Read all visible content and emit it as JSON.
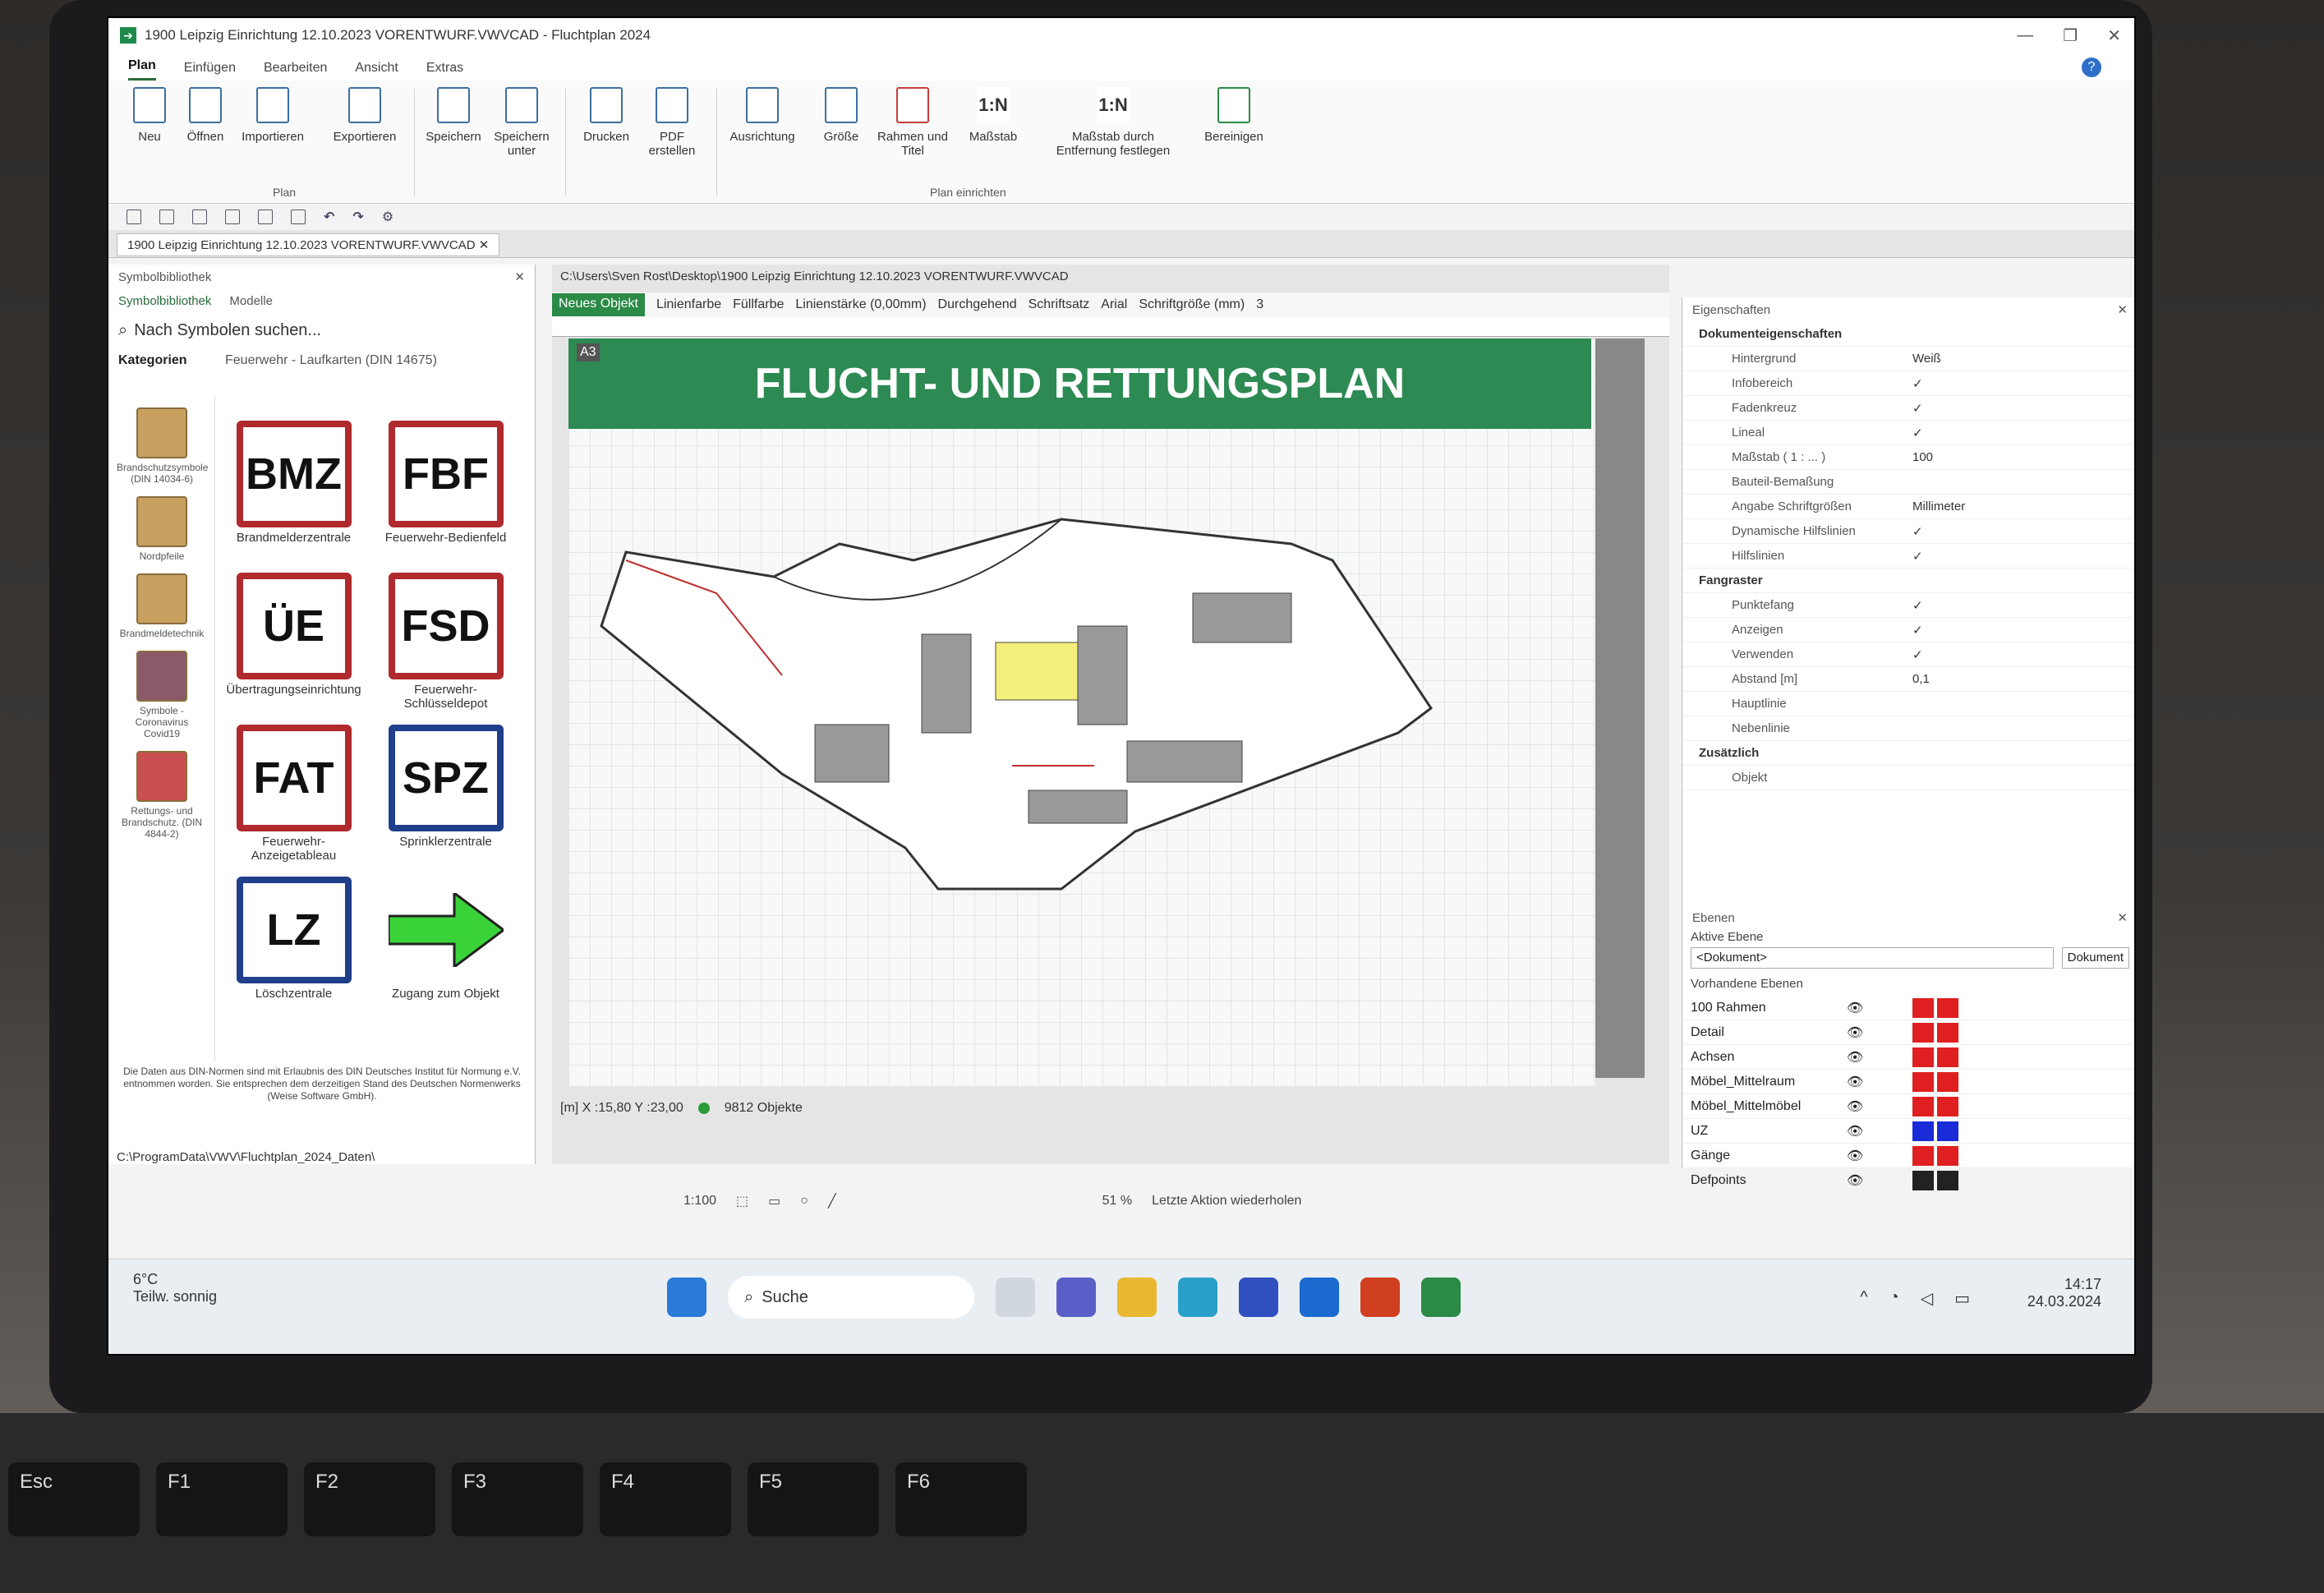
{
  "window": {
    "title": "1900 Leipzig Einrichtung 12.10.2023 VORENTWURF.VWVCAD - Fluchtplan 2024"
  },
  "ribbon": {
    "tabs": [
      "Plan",
      "Einfügen",
      "Bearbeiten",
      "Ansicht",
      "Extras"
    ],
    "buttons": {
      "neu": "Neu",
      "oeffnen": "Öffnen",
      "importieren": "Importieren",
      "exportieren": "Exportieren",
      "speichern": "Speichern",
      "speichern_unter": "Speichern unter",
      "drucken": "Drucken",
      "pdf": "PDF erstellen",
      "ausrichtung": "Ausrichtung",
      "groesse": "Größe",
      "rahmen": "Rahmen und Titel",
      "massstab": "Maßstab",
      "massstab_entf": "Maßstab durch Entfernung festlegen",
      "bereinigen": "Bereinigen"
    },
    "groups": {
      "plan": "Plan",
      "plan_einrichten": "Plan einrichten"
    },
    "scale_icon": "1:N"
  },
  "doc_tab": "1900 Leipzig Einrichtung 12.10.2023 VORENTWURF.VWVCAD",
  "library": {
    "title": "Symbolbibliothek",
    "tab_symbols": "Symbolbibliothek",
    "tab_models": "Modelle",
    "search_placeholder": "Nach Symbolen suchen...",
    "categories_label": "Kategorien",
    "folder": "Feuerwehr - Laufkarten (DIN 14675)",
    "categories": [
      "Brandschutzsymbole (DIN 14034-6)",
      "Nordpfeile",
      "Brandmeldetechnik",
      "Symbole - Coronavirus Covid19",
      "Rettungs- und Brandschutz. (DIN 4844-2)"
    ],
    "symbols": [
      {
        "code": "BMZ",
        "label": "Brandmelderzentrale"
      },
      {
        "code": "FBF",
        "label": "Feuerwehr-Bedienfeld"
      },
      {
        "code": "ÜE",
        "label": "Übertragungseinrichtung"
      },
      {
        "code": "FSD",
        "label": "Feuerwehr-Schlüsseldepot"
      },
      {
        "code": "FAT",
        "label": "Feuerwehr-Anzeigetableau"
      },
      {
        "code": "SPZ",
        "label": "Sprinklerzentrale"
      },
      {
        "code": "LZ",
        "label": "Löschzentrale"
      },
      {
        "code": "",
        "label": "Zugang zum Objekt"
      }
    ],
    "legal": "Die Daten aus DIN-Normen sind mit Erlaubnis des DIN Deutsches Institut für Normung e.V. entnommen worden. Sie entsprechen dem derzeitigen Stand des Deutschen Normenwerks (Weise Software GmbH).",
    "path": "C:\\ProgramData\\VWV\\Fluchtplan_2024_Daten\\"
  },
  "canvas": {
    "path": "C:\\Users\\Sven Rost\\Desktop\\1900 Leipzig Einrichtung 12.10.2023 VORENTWURF.VWVCAD",
    "new_object": "Neues Objekt",
    "toolbar": [
      "Linienfarbe",
      "Füllfarbe",
      "Linienstärke (0,00mm)",
      "Durchgehend",
      "Schriftsatz",
      "Arial",
      "Schriftgröße (mm)",
      "3"
    ],
    "paper": "A3",
    "plan_title": "FLUCHT- UND RETTUNGSPLAN",
    "coords": "[m] X :15,80 Y :23,00",
    "objects": "9812 Objekte",
    "scale": "1:100",
    "zoom": "51 %",
    "repeat": "Letzte Aktion wiederholen"
  },
  "properties": {
    "title": "Eigenschaften",
    "section_doc": "Dokumenteigenschaften",
    "rows": [
      {
        "name": "Hintergrund",
        "value": "Weiß"
      },
      {
        "name": "Infobereich",
        "value": "✓"
      },
      {
        "name": "Fadenkreuz",
        "value": "✓"
      },
      {
        "name": "Lineal",
        "value": "✓"
      },
      {
        "name": "Maßstab ( 1 : ... )",
        "value": "100"
      },
      {
        "name": "Bauteil-Bemaßung",
        "value": ""
      },
      {
        "name": "Angabe Schriftgrößen",
        "value": "Millimeter"
      },
      {
        "name": "Dynamische Hilfslinien",
        "value": "✓"
      },
      {
        "name": "Hilfslinien",
        "value": "✓"
      }
    ],
    "section_grid": "Fangraster",
    "grid_rows": [
      {
        "name": "Punktefang",
        "value": "✓"
      },
      {
        "name": "Anzeigen",
        "value": "✓"
      },
      {
        "name": "Verwenden",
        "value": "✓"
      },
      {
        "name": "Abstand [m]",
        "value": "0,1"
      },
      {
        "name": "Hauptlinie",
        "value": ""
      },
      {
        "name": "Nebenlinie",
        "value": ""
      }
    ],
    "section_extra": "Zusätzlich",
    "extra_rows": [
      {
        "name": "Objekt",
        "value": ""
      }
    ]
  },
  "layers": {
    "title": "Ebenen",
    "active_label": "Aktive Ebene",
    "active_value": "<Dokument>",
    "doc_button": "Dokument",
    "existing_label": "Vorhandene Ebenen",
    "items": [
      {
        "name": "100 Rahmen",
        "color": "#e02020"
      },
      {
        "name": "Detail",
        "color": "#e02020"
      },
      {
        "name": "Achsen",
        "color": "#e02020"
      },
      {
        "name": "Möbel_Mittelraum",
        "color": "#e02020"
      },
      {
        "name": "Möbel_Mittelmöbel",
        "color": "#e02020"
      },
      {
        "name": "UZ",
        "color": "#1a2bd8"
      },
      {
        "name": "Gänge",
        "color": "#e02020"
      },
      {
        "name": "Defpoints",
        "color": "#222222"
      }
    ]
  },
  "taskbar": {
    "weather_temp": "6°C",
    "weather_text": "Teilw. sonnig",
    "search": "Suche",
    "time": "14:17",
    "date": "24.03.2024"
  },
  "keyboard": [
    "Esc",
    "F1",
    "F2",
    "F3",
    "F4",
    "F5",
    "F6"
  ]
}
